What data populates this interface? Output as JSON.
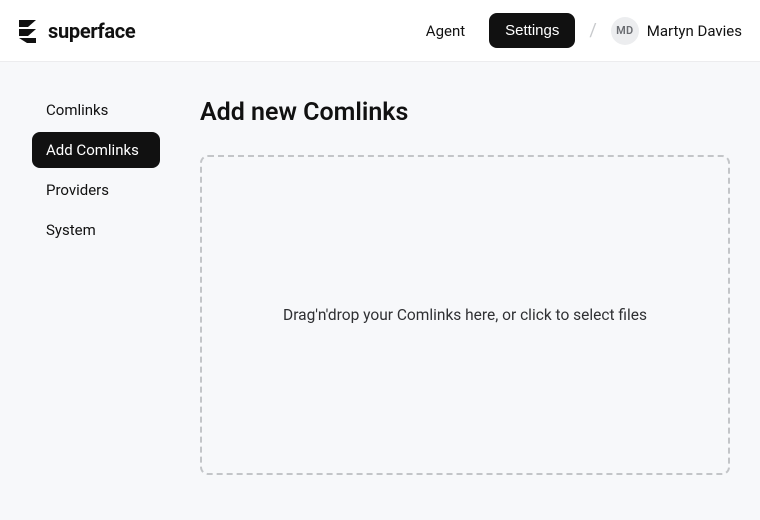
{
  "brand": {
    "name": "superface"
  },
  "header": {
    "nav": {
      "agent": "Agent",
      "settings": "Settings"
    },
    "user": {
      "initials": "MD",
      "name": "Martyn Davies"
    }
  },
  "sidebar": {
    "items": [
      {
        "label": "Comlinks"
      },
      {
        "label": "Add Comlinks"
      },
      {
        "label": "Providers"
      },
      {
        "label": "System"
      }
    ]
  },
  "main": {
    "title": "Add new Comlinks",
    "dropzone_text": "Drag'n'drop your Comlinks here, or click to select files"
  }
}
